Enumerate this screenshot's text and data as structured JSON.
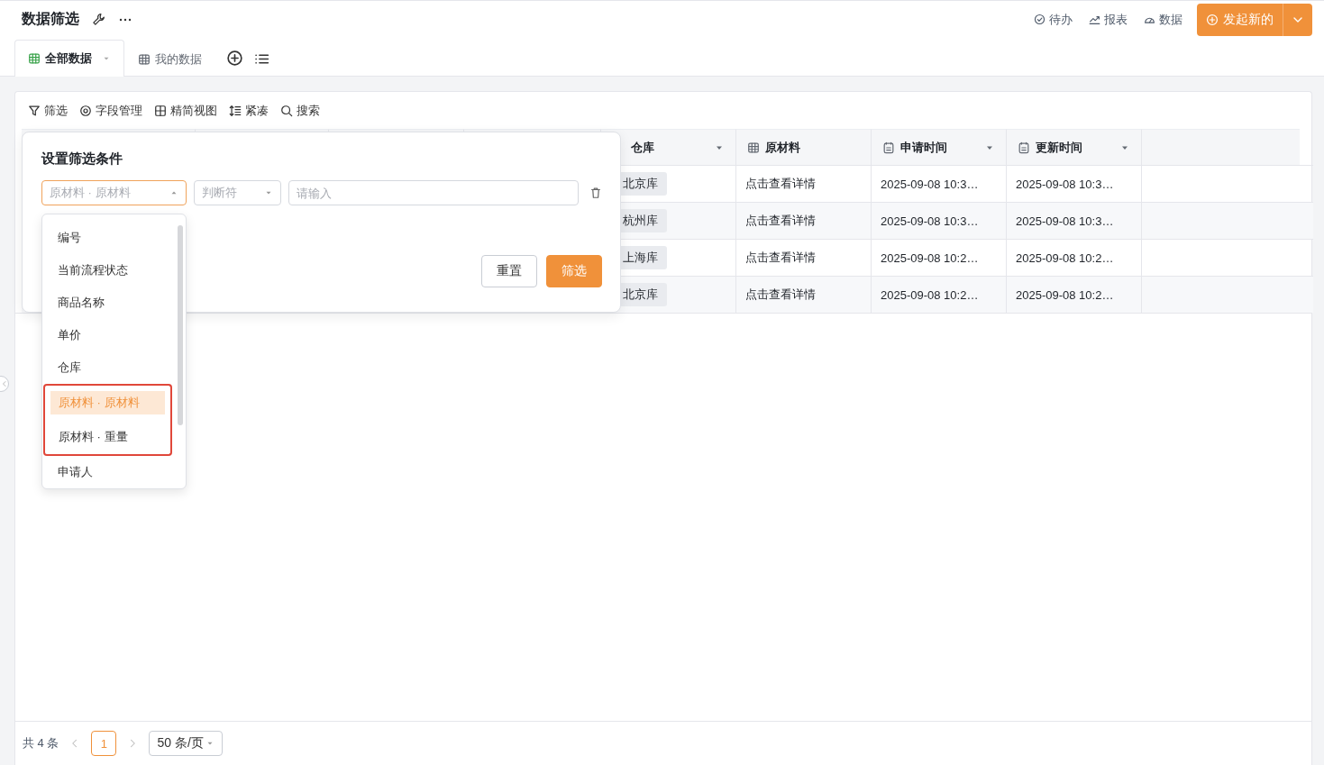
{
  "page": {
    "title": "数据筛选"
  },
  "header_actions": [
    {
      "label": "待办"
    },
    {
      "label": "报表"
    },
    {
      "label": "数据"
    }
  ],
  "primary_button": {
    "label": "发起新的"
  },
  "tabs": [
    {
      "label": "全部数据",
      "selected": true
    },
    {
      "label": "我的数据",
      "selected": false
    }
  ],
  "toolbar": [
    "筛选",
    "字段管理",
    "精简视图",
    "紧凑",
    "搜索"
  ],
  "table": {
    "columns": [
      {
        "label": "仓库"
      },
      {
        "label": "原材料"
      },
      {
        "label": "申请时间"
      },
      {
        "label": "更新时间"
      }
    ],
    "rows": [
      {
        "cells": [
          "北京库",
          "点击查看详情",
          "2025-09-08 10:3…",
          "2025-09-08 10:3…"
        ]
      },
      {
        "cells": [
          "杭州库",
          "点击查看详情",
          "2025-09-08 10:3…",
          "2025-09-08 10:3…"
        ]
      },
      {
        "cells": [
          "上海库",
          "点击查看详情",
          "2025-09-08 10:2…",
          "2025-09-08 10:2…"
        ]
      },
      {
        "cells": [
          "北京库",
          "点击查看详情",
          "2025-09-08 10:2…",
          "2025-09-08 10:2…"
        ]
      }
    ]
  },
  "filter_popover": {
    "title": "设置筛选条件",
    "field": {
      "value": "原材料 · 原材料"
    },
    "operator": {
      "placeholder": "判断符"
    },
    "input": {
      "placeholder": "请输入"
    },
    "buttons": [
      "重置",
      "筛选"
    ]
  },
  "field_options": [
    {
      "label": "编号",
      "selected": false,
      "highlighted": false
    },
    {
      "label": "当前流程状态",
      "selected": false,
      "highlighted": false
    },
    {
      "label": "商品名称",
      "selected": false,
      "highlighted": false
    },
    {
      "label": "单价",
      "selected": false,
      "highlighted": false
    },
    {
      "label": "仓库",
      "selected": false,
      "highlighted": false
    },
    {
      "label": "原材料 · 原材料",
      "selected": true,
      "highlighted": true
    },
    {
      "label": "原材料 · 重量",
      "selected": false,
      "highlighted": true
    },
    {
      "label": "申请人",
      "selected": false,
      "highlighted": false
    }
  ],
  "pagination": {
    "total": "共 4 条",
    "pages": [
      {
        "label": "1",
        "selected": true
      }
    ],
    "page_size": "50 条/页"
  }
}
